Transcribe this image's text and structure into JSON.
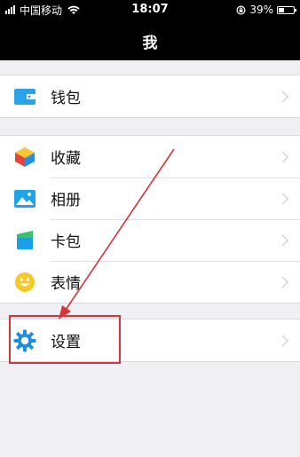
{
  "status_bar": {
    "carrier": "中国移动",
    "time": "18:07",
    "battery": "39%",
    "battery_level": 0.39
  },
  "nav": {
    "title": "我"
  },
  "groups": [
    {
      "items": [
        {
          "label": "钱包",
          "icon": "wallet-icon"
        }
      ]
    },
    {
      "items": [
        {
          "label": "收藏",
          "icon": "favorites-cube-icon"
        },
        {
          "label": "相册",
          "icon": "album-image-icon"
        },
        {
          "label": "卡包",
          "icon": "card-pack-icon"
        },
        {
          "label": "表情",
          "icon": "smiley-icon"
        }
      ]
    },
    {
      "items": [
        {
          "label": "设置",
          "icon": "settings-gear-icon"
        }
      ]
    }
  ],
  "annotation": {
    "color": "#d9333a"
  }
}
